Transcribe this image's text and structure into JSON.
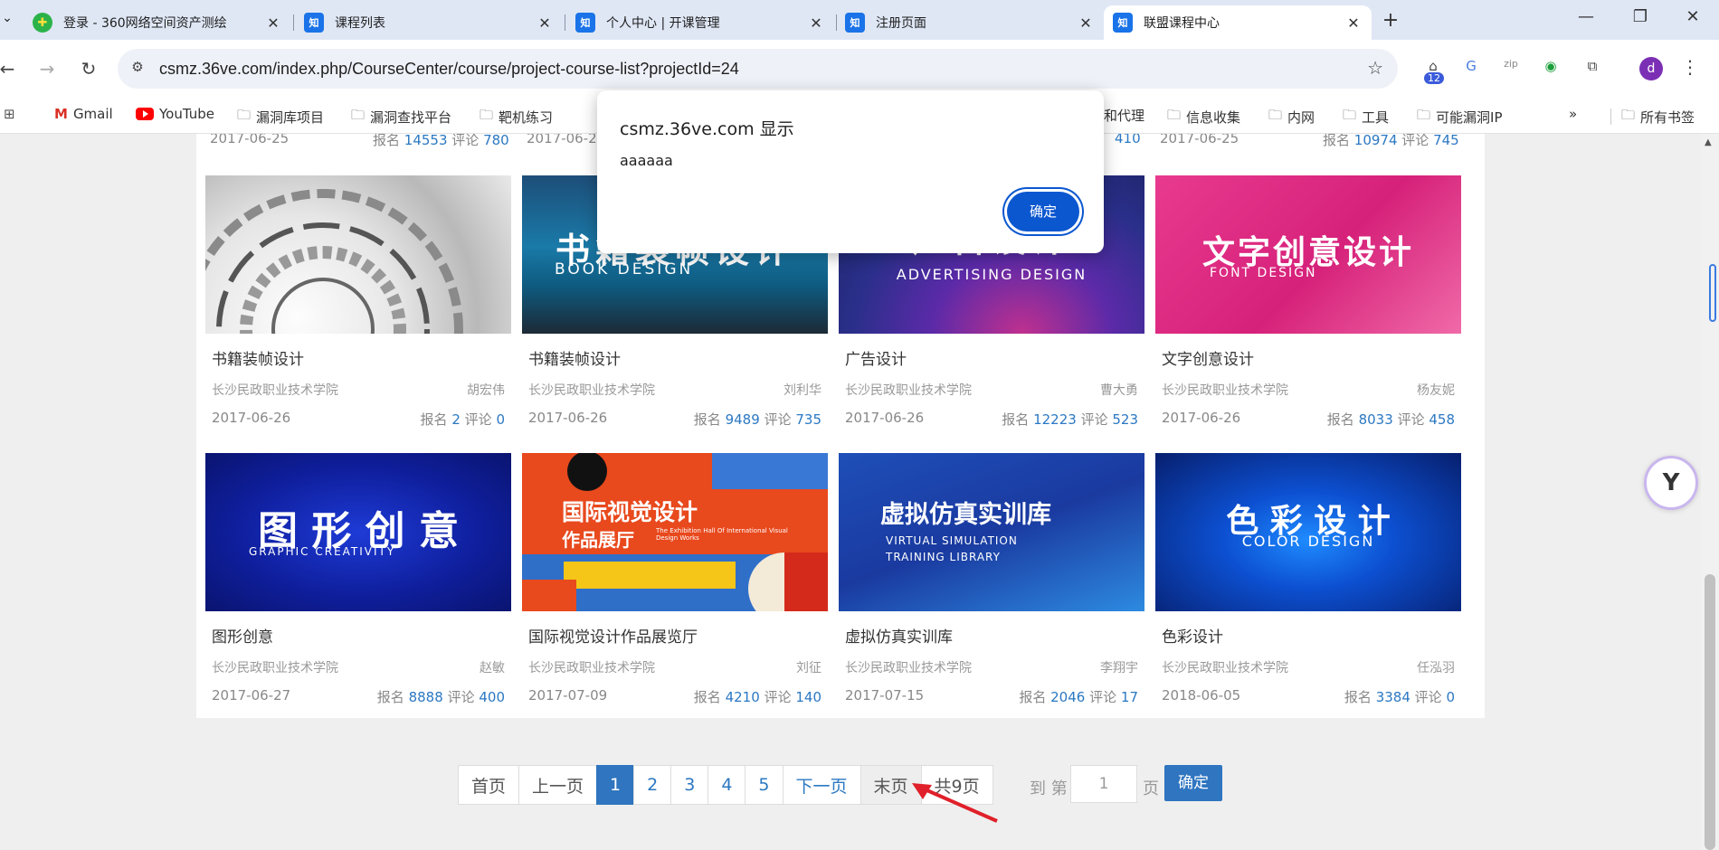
{
  "browser": {
    "tabs": [
      {
        "title": "登录 - 360网络空间资产测绘",
        "favicon": "360-logo"
      },
      {
        "title": "课程列表",
        "favicon": "zhi-logo"
      },
      {
        "title": "个人中心 | 开课管理",
        "favicon": "zhi-logo"
      },
      {
        "title": "注册页面",
        "favicon": "zhi-logo"
      },
      {
        "title": "联盟课程中心",
        "favicon": "zhi-logo",
        "active": true
      }
    ],
    "url": "csmz.36ve.com/index.php/CourseCenter/course/project-course-list?projectId=24",
    "extension_badge": "12",
    "profile_initial": "d",
    "favicon_text": "知",
    "bookmarks": [
      "Gmail",
      "YouTube",
      "漏洞库项目",
      "漏洞查找平台",
      "靶机练习",
      "和代理",
      "信息收集",
      "内网",
      "工具",
      "可能漏洞IP",
      "所有书签"
    ]
  },
  "top_row": {
    "col1": {
      "date": "2017-06-25",
      "enroll": "14553",
      "comments": "780"
    },
    "col2": {
      "date": "2017-06-2"
    },
    "col3": {
      "comments": "410"
    },
    "col4": {
      "date": "2017-06-25",
      "enroll": "10974",
      "comments": "745"
    }
  },
  "labels": {
    "enroll": "报名",
    "comments": "评论"
  },
  "courses": [
    {
      "title": "书籍装帧设计",
      "school": "长沙民政职业技术学院",
      "teacher": "胡宏伟",
      "date": "2017-06-26",
      "enroll": "2",
      "comments": "0",
      "banner": ""
    },
    {
      "title": "书籍装帧设计",
      "school": "长沙民政职业技术学院",
      "teacher": "刘利华",
      "date": "2017-06-26",
      "enroll": "9489",
      "comments": "735",
      "banner": "书籍装帧设计",
      "banner_en": "BOOK DESIGN"
    },
    {
      "title": "广告设计",
      "school": "长沙民政职业技术学院",
      "teacher": "曹大勇",
      "date": "2017-06-26",
      "enroll": "12223",
      "comments": "523",
      "banner": "广告设计",
      "banner_en": "ADVERTISING DESIGN"
    },
    {
      "title": "文字创意设计",
      "school": "长沙民政职业技术学院",
      "teacher": "杨友妮",
      "date": "2017-06-26",
      "enroll": "8033",
      "comments": "458",
      "banner": "文字创意设计",
      "banner_en": "FONT DESIGN"
    },
    {
      "title": "图形创意",
      "school": "长沙民政职业技术学院",
      "teacher": "赵敏",
      "date": "2017-06-27",
      "enroll": "8888",
      "comments": "400",
      "banner": "图 形 创 意",
      "banner_en": "GRAPHIC CREATIVITY"
    },
    {
      "title": "国际视觉设计作品展览厅",
      "school": "长沙民政职业技术学院",
      "teacher": "刘征",
      "date": "2017-07-09",
      "enroll": "4210",
      "comments": "140",
      "banner": "国际视觉设计",
      "banner2": "作品展厅",
      "banner_en": "The Exhibition Hall Of International Visual Design Works"
    },
    {
      "title": "虚拟仿真实训库",
      "school": "长沙民政职业技术学院",
      "teacher": "李翔宇",
      "date": "2017-07-15",
      "enroll": "2046",
      "comments": "17",
      "banner": "虚拟仿真实训库",
      "banner_en": "VIRTUAL SIMULATION",
      "banner_en2": "TRAINING LIBRARY"
    },
    {
      "title": "色彩设计",
      "school": "长沙民政职业技术学院",
      "teacher": "任泓羽",
      "date": "2018-06-05",
      "enroll": "3384",
      "comments": "0",
      "banner": "色 彩 设 计",
      "banner_en": "COLOR DESIGN"
    }
  ],
  "pagination": {
    "first": "首页",
    "prev": "上一页",
    "pages": [
      "1",
      "2",
      "3",
      "4",
      "5"
    ],
    "next": "下一页",
    "last": "末页",
    "total": "共9页",
    "goto_prefix": "到 第",
    "goto_value": "1",
    "goto_suffix": "页",
    "goto_button": "确定"
  },
  "alert": {
    "title": "csmz.36ve.com 显示",
    "message": "aaaaaa",
    "ok": "确定"
  },
  "colors": {
    "accent": "#2f75c0",
    "link": "#2b78c2",
    "dialog_button": "#0b57d0"
  }
}
